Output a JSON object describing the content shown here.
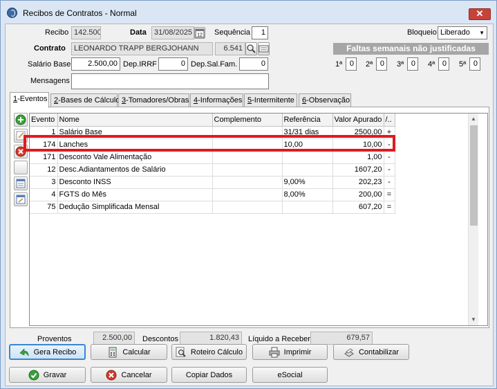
{
  "window": {
    "title": "Recibos de Contratos - Normal",
    "close_symbol": "✕"
  },
  "header": {
    "recibo_label": "Recibo",
    "recibo_value": "142.500",
    "data_label": "Data",
    "data_value": "31/08/2025",
    "sequencia_label": "Sequência",
    "sequencia_value": "1",
    "bloqueio_label": "Bloqueio",
    "bloqueio_value": "Liberado",
    "contrato_label": "Contrato",
    "contrato_nome": "LEONARDO TRAPP BERGJOHANN",
    "contrato_codigo": "6.541",
    "salario_label": "Salário Base",
    "salario_value": "2.500,00",
    "dep_irrf_label": "Dep.IRRF",
    "dep_irrf_value": "0",
    "dep_salfam_label": "Dep.Sal.Fam.",
    "dep_salfam_value": "0",
    "mensagens_label": "Mensagens",
    "mensagens_value": ""
  },
  "faltas": {
    "title": "Faltas semanais não justificadas",
    "weeks": [
      {
        "label": "1ª",
        "value": "0"
      },
      {
        "label": "2ª",
        "value": "0"
      },
      {
        "label": "3ª",
        "value": "0"
      },
      {
        "label": "4ª",
        "value": "0"
      },
      {
        "label": "5ª",
        "value": "0"
      }
    ]
  },
  "tabs": [
    {
      "key": "1",
      "label": "-Eventos"
    },
    {
      "key": "2",
      "label": "-Bases de Cálculo"
    },
    {
      "key": "3",
      "label": "-Tomadores/Obras"
    },
    {
      "key": "4",
      "label": "-Informações"
    },
    {
      "key": "5",
      "label": "-Intermitente"
    },
    {
      "key": "6",
      "label": "-Observação"
    }
  ],
  "grid": {
    "columns": [
      "Evento",
      "Nome",
      "Complemento",
      "Referência",
      "Valor Apurado",
      "/.."
    ],
    "rows": [
      [
        "1",
        "Salário Base",
        "",
        "31/31 dias",
        "2500,00",
        "+"
      ],
      [
        "174",
        "Lanches",
        "",
        "10,00",
        "10,00",
        "-"
      ],
      [
        "171",
        "Desconto Vale Alimentação",
        "",
        "",
        "1,00",
        "-"
      ],
      [
        "12",
        "Desc.Adiantamentos de Salário",
        "",
        "",
        "1607,20",
        "-"
      ],
      [
        "3",
        "Desconto INSS",
        "",
        "9,00%",
        "202,23",
        "-"
      ],
      [
        "4",
        "FGTS do Mês",
        "",
        "8,00%",
        "200,00",
        "="
      ],
      [
        "75",
        "Dedução Simplificada Mensal",
        "",
        "",
        "607,20",
        "="
      ]
    ]
  },
  "totals": {
    "proventos_label": "Proventos",
    "proventos_value": "2.500,00",
    "descontos_label": "Descontos",
    "descontos_value": "1.820,43",
    "liquido_label": "Líquido a Receber",
    "liquido_value": "679,57"
  },
  "actions": {
    "gera_recibo": "Gera Recibo",
    "calcular": "Calcular",
    "roteiro": "Roteiro Cálculo",
    "imprimir": "Imprimir",
    "contabilizar": "Contabilizar",
    "gravar": "Gravar",
    "cancelar": "Cancelar",
    "copiar": "Copiar Dados",
    "esocial": "eSocial"
  }
}
